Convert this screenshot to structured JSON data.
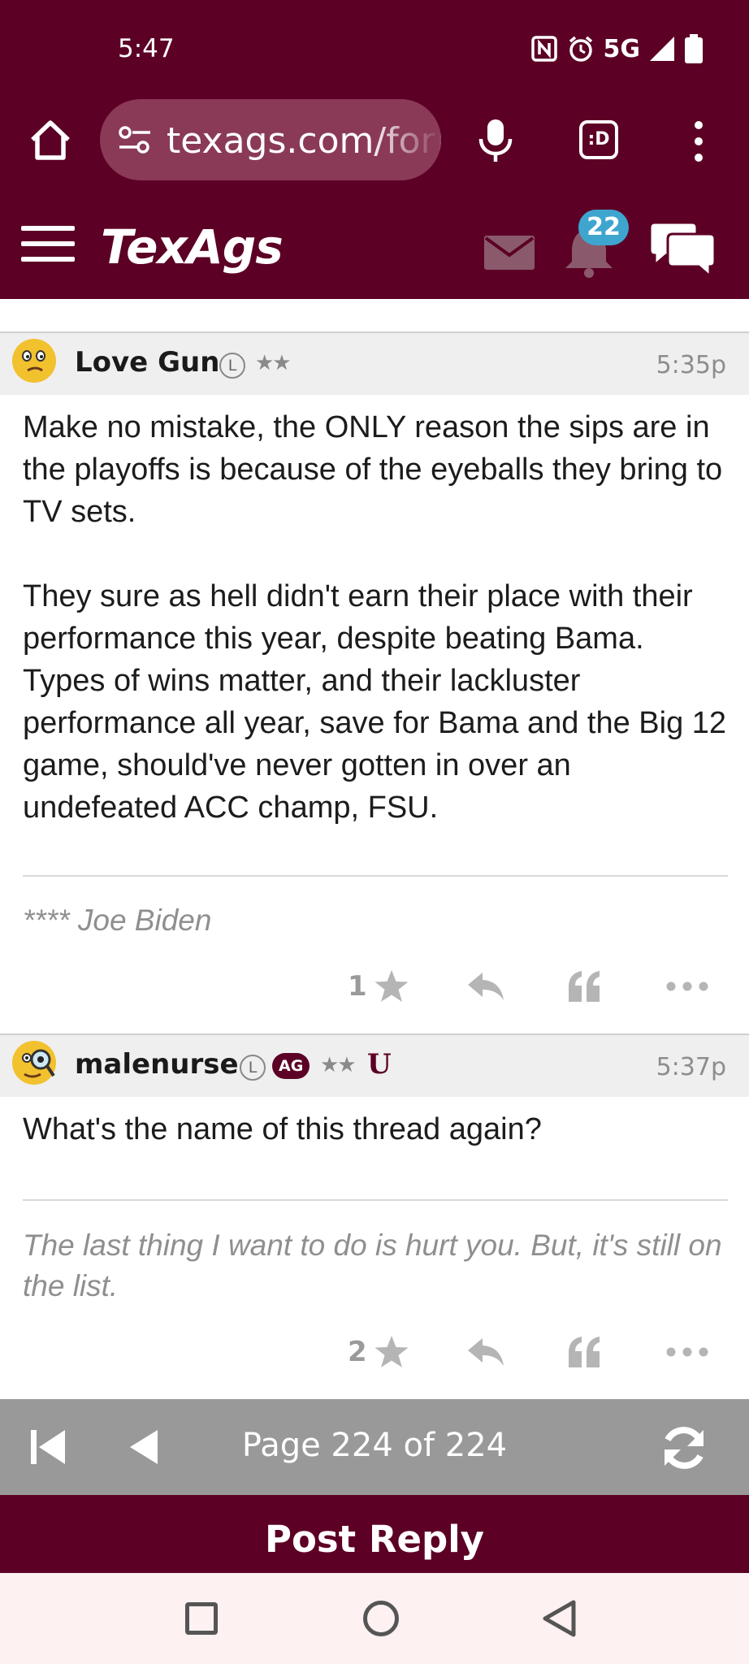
{
  "status_bar": {
    "time": "5:47",
    "network": "5G"
  },
  "browser": {
    "url": "texags.com/forums",
    "tab_button_label": ":D"
  },
  "site": {
    "logo_text": "TexAgs",
    "notification_count": "22",
    "brand_color": "#5c0025",
    "badge_color": "#3ea5cf"
  },
  "posts": [
    {
      "username": "Love Gun",
      "badges": [
        "L"
      ],
      "stars": "★★",
      "time": "5:35p",
      "avatar_icon": "confused-smiley-icon",
      "paragraphs": [
        "Make no mistake, the ONLY reason the sips are in the playoffs is because of the eyeballs they bring to TV sets.",
        "They sure as hell didn't earn their place with their performance this year, despite beating Bama. Types of wins matter, and their lackluster performance all year, save for Bama and the Big 12 game, should've never gotten in over an undefeated ACC champ, FSU."
      ],
      "signature": "**** Joe Biden",
      "likes": "1"
    },
    {
      "username": "malenurse",
      "badges": [
        "L",
        "AG"
      ],
      "stars": "★★",
      "time": "5:37p",
      "avatar_icon": "magnifying-glass-smiley-icon",
      "paragraphs": [
        "What's the name of this thread again?"
      ],
      "signature": "The last thing I want to do is hurt you. But, it's still on the list.",
      "likes": "2"
    }
  ],
  "pager": {
    "label": "Page 224 of 224"
  },
  "reply": {
    "label": "Post Reply"
  }
}
